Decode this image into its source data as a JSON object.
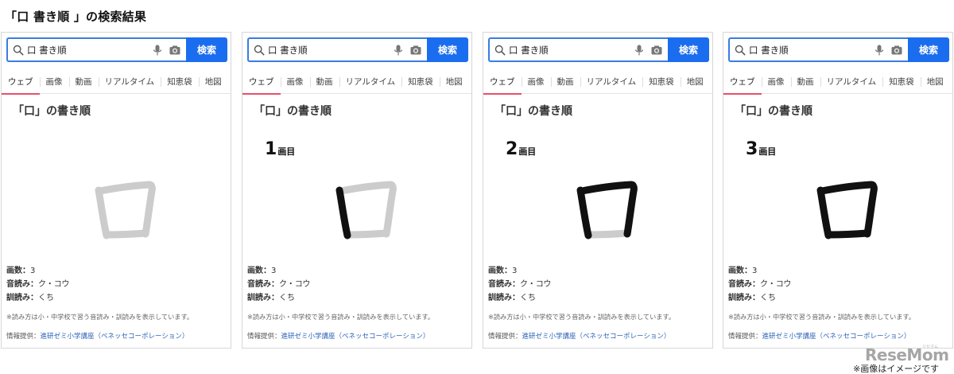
{
  "page": {
    "heading": "「口 書き順 」の検索結果",
    "caption": "※画像はイメージです",
    "logo": "ReseMom",
    "logo_sub": "リセマム"
  },
  "colors": {
    "accent_blue": "#1a6dee",
    "active_tab_underline": "#e8506a",
    "stroke_done": "#111111",
    "stroke_pending": "#cccccc",
    "link": "#2d63b8"
  },
  "search": {
    "query": "口 書き順",
    "button_label": "検索",
    "icons": [
      "search-icon",
      "microphone-icon",
      "camera-icon"
    ]
  },
  "tabs": [
    "ウェブ",
    "画像",
    "動画",
    "リアルタイム",
    "知恵袋",
    "地図"
  ],
  "result": {
    "title": "「口」の書き順",
    "stroke_count_label": "画数：",
    "stroke_count": "3",
    "on_label": "音読み：",
    "on_reading": "ク・コウ",
    "kun_label": "訓読み：",
    "kun_reading": "くち",
    "note": "※読み方は小・中学校で習う音読み・訓読みを表示しています。",
    "source_label": "情報提供：",
    "source_link": "進研ゼミ小学講座（ベネッセコーポレーション）",
    "step_unit": "画目"
  },
  "panels": [
    {
      "step_label": "",
      "strokes_drawn": 0
    },
    {
      "step_label": "1",
      "strokes_drawn": 1
    },
    {
      "step_label": "2",
      "strokes_drawn": 2
    },
    {
      "step_label": "3",
      "strokes_drawn": 3
    }
  ]
}
